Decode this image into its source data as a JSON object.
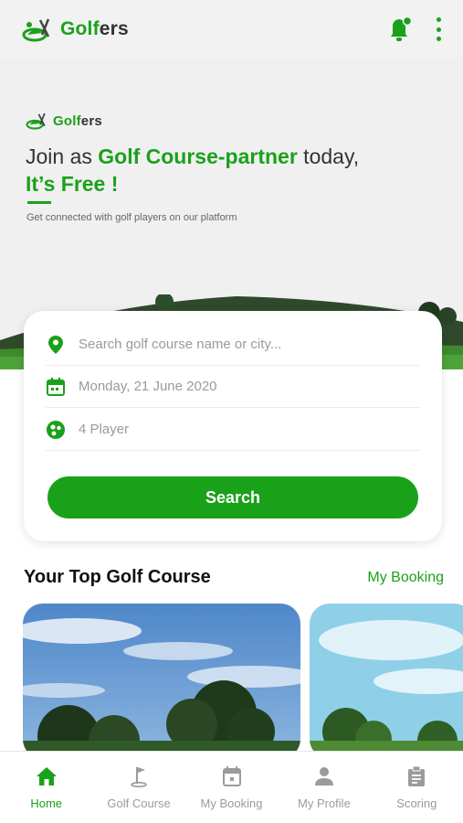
{
  "app": {
    "logo_prefix": "Golf",
    "logo_suffix": "ers"
  },
  "hero": {
    "logo_prefix": "Golf",
    "logo_suffix": "ers",
    "title_start": "Join as ",
    "title_highlight": "Golf Course-partner",
    "title_end": " today,",
    "title_free": "It’s Free !",
    "subtitle": "Get connected with golf players on our platform"
  },
  "search": {
    "location_placeholder": "Search golf course name or city...",
    "date_value": "Monday, 21 June 2020",
    "players_value": "4 Player",
    "button_label": "Search"
  },
  "section": {
    "title": "Your Top Golf Course",
    "link": "My Booking"
  },
  "bottom_nav": [
    {
      "label": "Home",
      "icon": "home-icon",
      "active": true
    },
    {
      "label": "Golf Course",
      "icon": "flag-icon",
      "active": false
    },
    {
      "label": "My Booking",
      "icon": "calendar-icon",
      "active": false
    },
    {
      "label": "My Profile",
      "icon": "person-icon",
      "active": false
    },
    {
      "label": "Scoring",
      "icon": "clipboard-icon",
      "active": false
    }
  ],
  "colors": {
    "brand": "#1aa11a",
    "inactive": "#9b9b9b"
  }
}
